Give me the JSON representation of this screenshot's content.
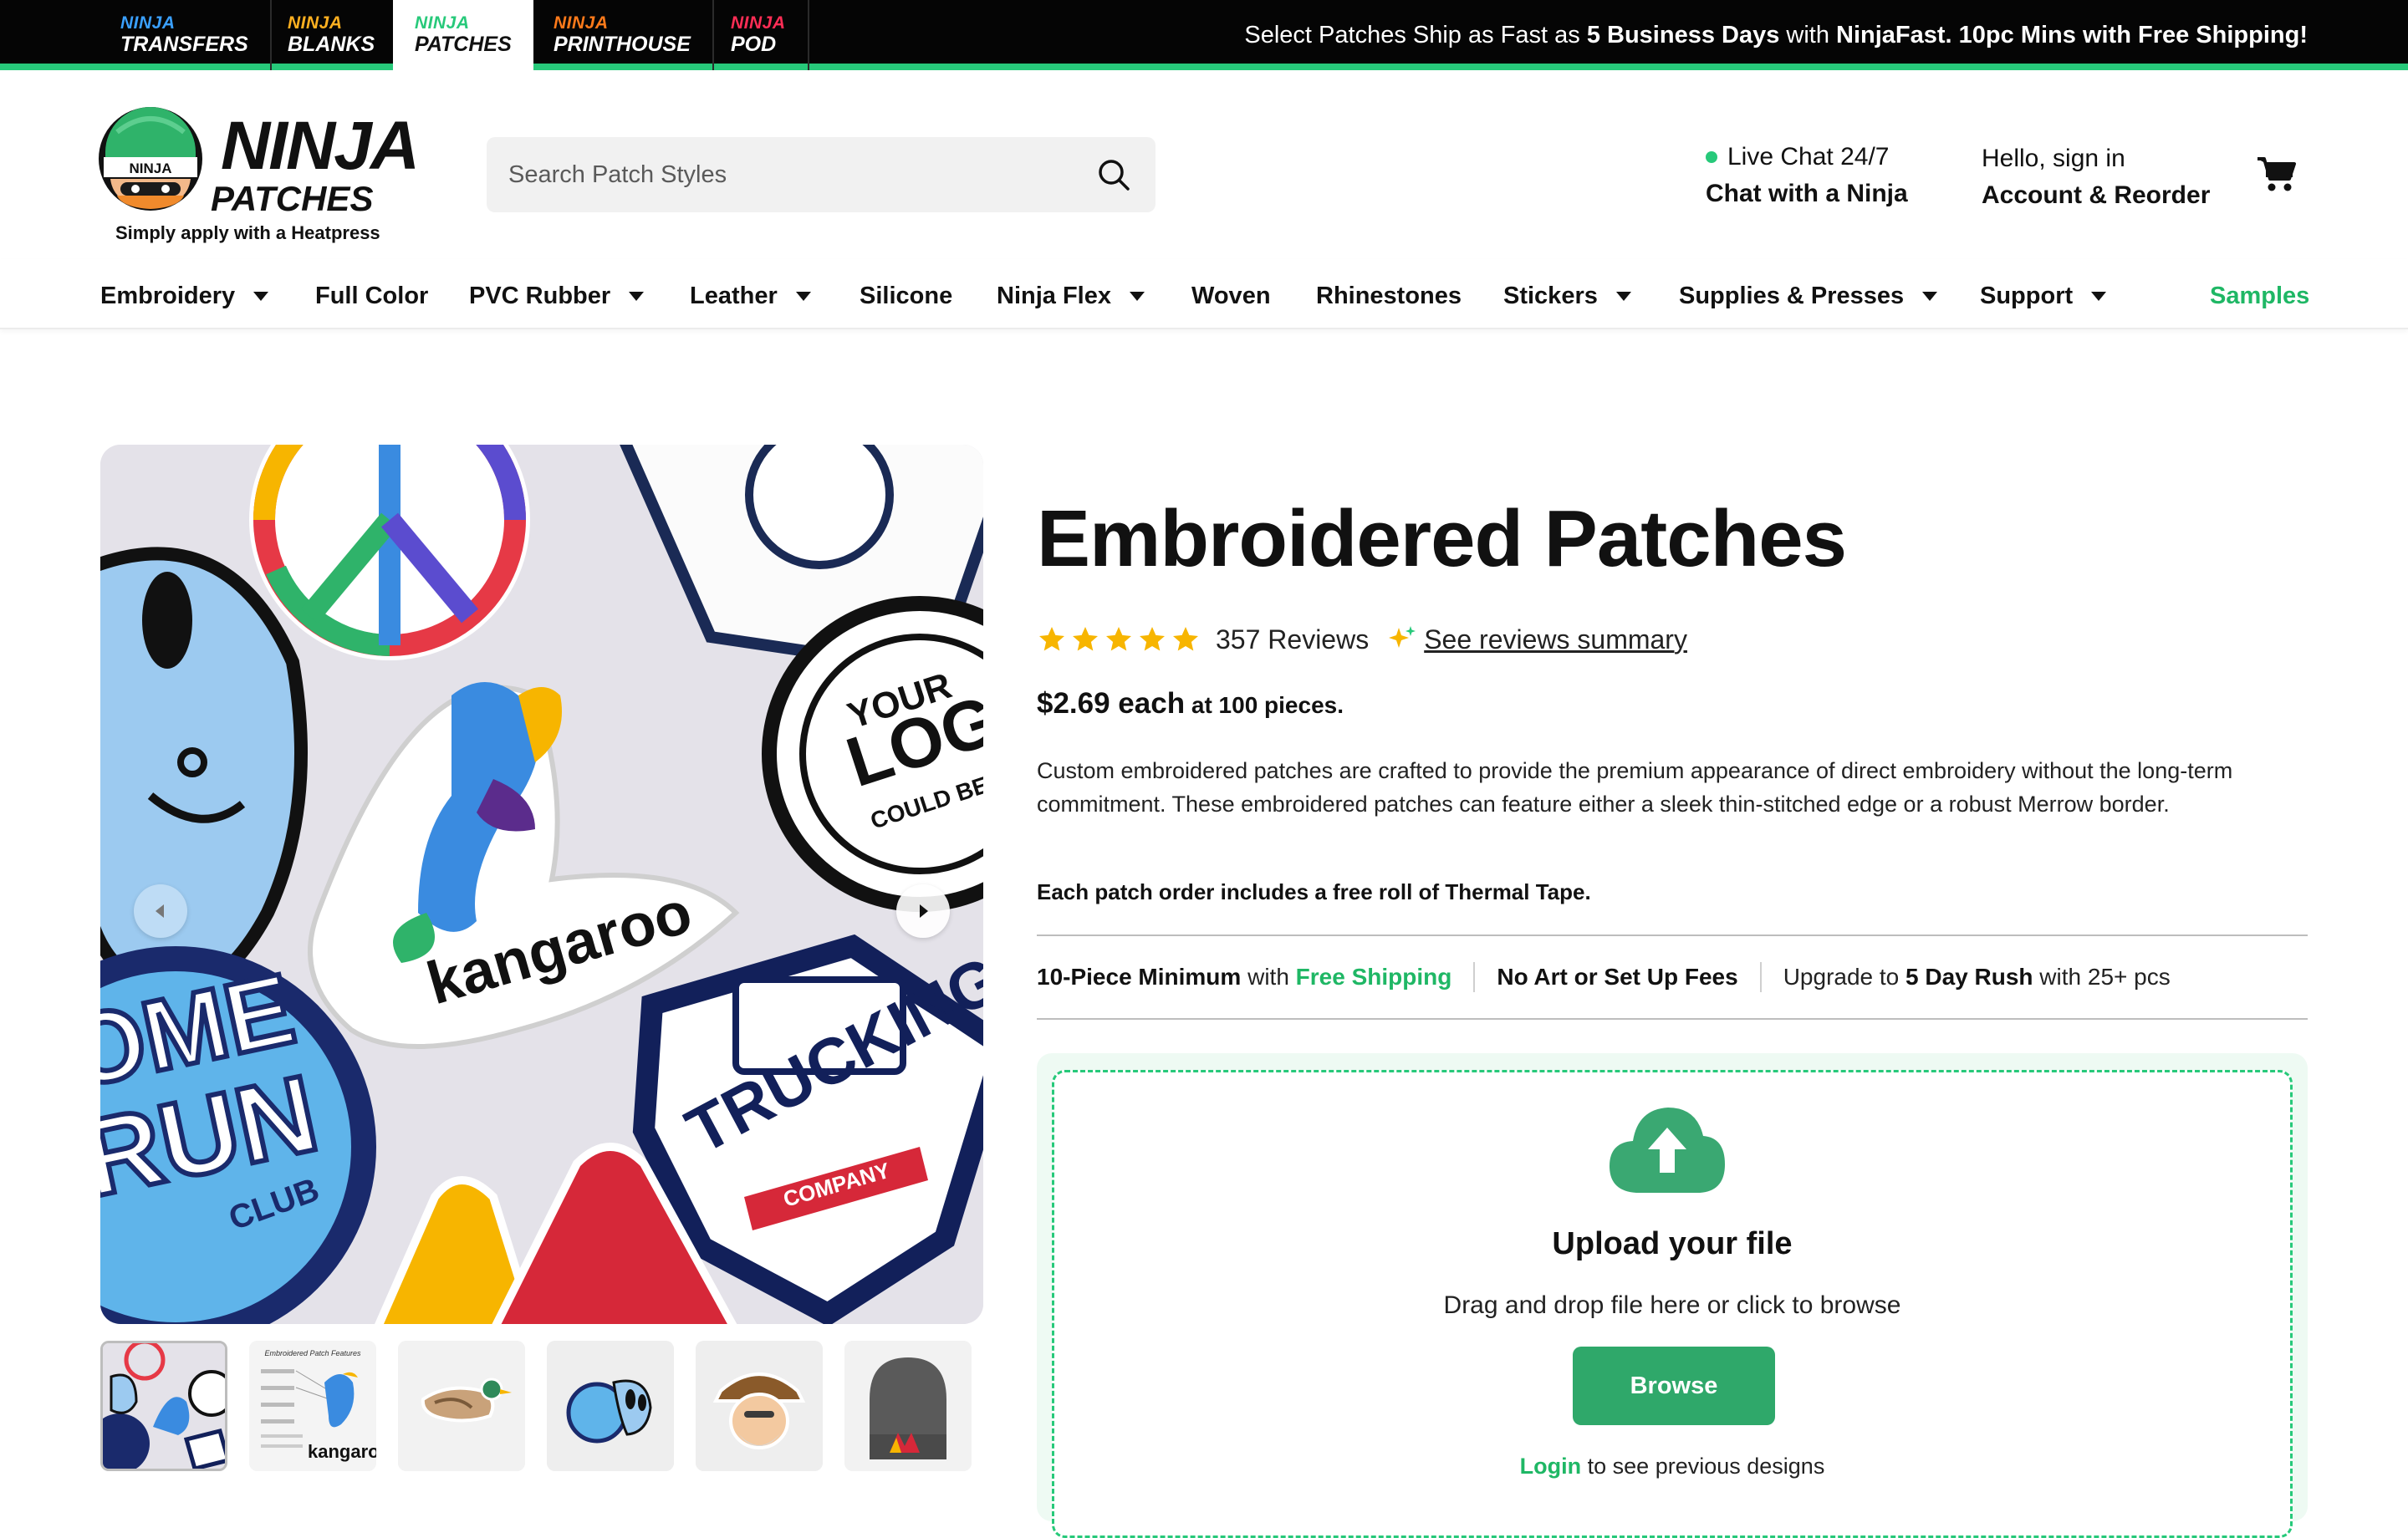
{
  "brand_tabs": [
    {
      "small": "NINJA",
      "big": "TRANSFERS",
      "color": "#3aa0ff"
    },
    {
      "small": "NINJA",
      "big": "BLANKS",
      "color": "#ffb020"
    },
    {
      "small": "NINJA",
      "big": "PATCHES",
      "color": "#27c97a"
    },
    {
      "small": "NINJA",
      "big": "PRINTHOUSE",
      "color": "#ff7a1a"
    },
    {
      "small": "NINJA",
      "big": "POD",
      "color": "#ff2d55"
    }
  ],
  "promo": {
    "t1": "Select Patches Ship as Fast as ",
    "b1": "5 Business Days",
    "t2": " with ",
    "b2": "NinjaFast. 10pc Mins with Free Shipping!"
  },
  "logo": {
    "word1": "NINJA",
    "word2": "PATCHES",
    "helmet_text": "NINJA",
    "tagline": "Simply apply with a Heatpress"
  },
  "search": {
    "placeholder": "Search Patch Styles"
  },
  "chat": {
    "line1": "Live Chat 24/7",
    "line2": "Chat with a Ninja"
  },
  "account": {
    "line1": "Hello, sign in",
    "line2": "Account & Reorder"
  },
  "nav": [
    {
      "label": "Embroidery"
    },
    {
      "label": "Full Color"
    },
    {
      "label": "PVC Rubber"
    },
    {
      "label": "Leather"
    },
    {
      "label": "Silicone"
    },
    {
      "label": "Ninja Flex"
    },
    {
      "label": "Woven"
    },
    {
      "label": "Rhinestones"
    },
    {
      "label": "Stickers"
    },
    {
      "label": "Supplies & Presses"
    },
    {
      "label": "Support"
    },
    {
      "label": "Samples"
    }
  ],
  "gallery": {
    "patch_texts": [
      "kangaroo",
      "YOUR",
      "LOGO",
      "COULD BE HERE",
      "OME",
      "RUN",
      "CLUB",
      "TRUCKING",
      "COMPANY"
    ],
    "thumb2_title": "Embroidered Patch Features",
    "thumb2_word": "kangaroo"
  },
  "product": {
    "title": "Embroidered Patches",
    "rating": 5,
    "reviews": "357 Reviews",
    "summary_link": "See reviews summary",
    "price": "$2.69 each",
    "price_suffix": " at 100 pieces.",
    "description": "Custom embroidered patches are crafted to provide the premium appearance of direct embroidery without the long-term commitment. These embroidered patches can feature either a sleek thin-stitched edge or a robust Merrow border.",
    "note": "Each patch order includes a free roll of Thermal Tape.",
    "features": {
      "f1_bold": "10-Piece Minimum",
      "f1_text": " with ",
      "f1_green": "Free Shipping",
      "f2_bold": "No Art or Set Up Fees",
      "f3_text": "Upgrade to ",
      "f3_bold": "5 Day Rush",
      "f3_tail": " with 25+ pcs"
    }
  },
  "upload": {
    "title": "Upload your file",
    "subtitle": "Drag and drop file here or click to browse",
    "button": "Browse",
    "login_link": "Login",
    "login_text": " to see previous designs"
  },
  "colors": {
    "accent": "#27c97a",
    "button": "#2fa86a",
    "star": "#f7b500"
  }
}
